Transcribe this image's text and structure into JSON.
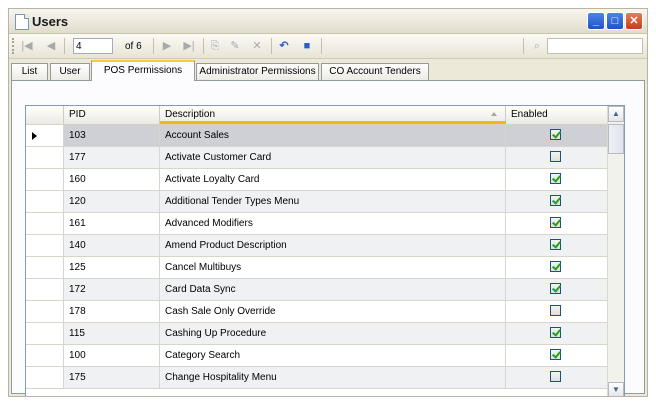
{
  "window": {
    "title": "Users"
  },
  "toolbar": {
    "first": "|◀",
    "prev": "◀",
    "position_value": "4",
    "of_label": "of 6",
    "next": "▶",
    "last": "▶|",
    "add": "⎘",
    "edit": "✎",
    "delete": "✕",
    "undo": "↶",
    "save": "■",
    "find": "⌕"
  },
  "tabs": [
    {
      "label": "List"
    },
    {
      "label": "User"
    },
    {
      "label": "POS Permissions"
    },
    {
      "label": "Administrator Permissions"
    },
    {
      "label": "CO Account Tenders"
    }
  ],
  "grid": {
    "columns": {
      "pid": "PID",
      "description": "Description",
      "enabled": "Enabled"
    },
    "rows": [
      {
        "pid": "103",
        "description": "Account Sales",
        "enabled": true
      },
      {
        "pid": "177",
        "description": "Activate Customer Card",
        "enabled": false
      },
      {
        "pid": "160",
        "description": "Activate Loyalty Card",
        "enabled": true
      },
      {
        "pid": "120",
        "description": "Additional Tender Types Menu",
        "enabled": true
      },
      {
        "pid": "161",
        "description": "Advanced Modifiers",
        "enabled": true
      },
      {
        "pid": "140",
        "description": "Amend Product Description",
        "enabled": true
      },
      {
        "pid": "125",
        "description": "Cancel Multibuys",
        "enabled": true
      },
      {
        "pid": "172",
        "description": "Card Data Sync",
        "enabled": true
      },
      {
        "pid": "178",
        "description": "Cash Sale Only Override",
        "enabled": false
      },
      {
        "pid": "115",
        "description": "Cashing Up Procedure",
        "enabled": true
      },
      {
        "pid": "100",
        "description": "Category Search",
        "enabled": true
      },
      {
        "pid": "175",
        "description": "Change Hospitality Menu",
        "enabled": false
      }
    ]
  }
}
